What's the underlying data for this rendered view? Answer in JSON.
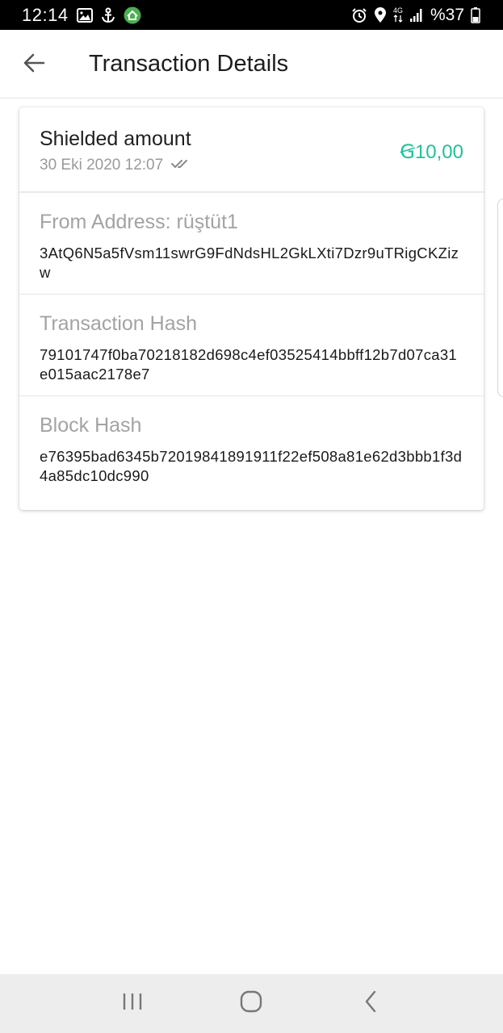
{
  "status_bar": {
    "time": "12:14",
    "network_label": "4G",
    "battery_text": "%37",
    "icons": [
      "image-icon",
      "anchor-icon",
      "app-notification-icon",
      "alarm-icon",
      "location-icon",
      "network-4g-icon",
      "signal-icon",
      "battery-icon"
    ],
    "app_icon_color": "#4caf50"
  },
  "app_bar": {
    "back_icon": "arrow-left-icon",
    "title": "Transaction Details"
  },
  "transaction": {
    "title": "Shielded amount",
    "date": "30 Eki 2020 12:07",
    "status_icon": "double-check-icon",
    "amount": "Ꞡ10,00",
    "amount_color": "#1fc29a"
  },
  "sections": {
    "from": {
      "label": "From Address: rüştüt1",
      "value": "3AtQ6N5a5fVsm11swrG9FdNdsHL2GkLXti7Dzr9uTRigCKZizw"
    },
    "tx_hash": {
      "label": "Transaction Hash",
      "value": "79101747f0ba70218182d698c4ef03525414bbff12b7d07ca31e015aac2178e7"
    },
    "block_hash": {
      "label": "Block Hash",
      "value": "e76395bad6345b72019841891911f22ef508a81e62d3bbb1f3d4a85dc10dc990"
    }
  },
  "nav_bar": {
    "icons": [
      "recent-apps-icon",
      "home-icon",
      "back-icon"
    ]
  }
}
